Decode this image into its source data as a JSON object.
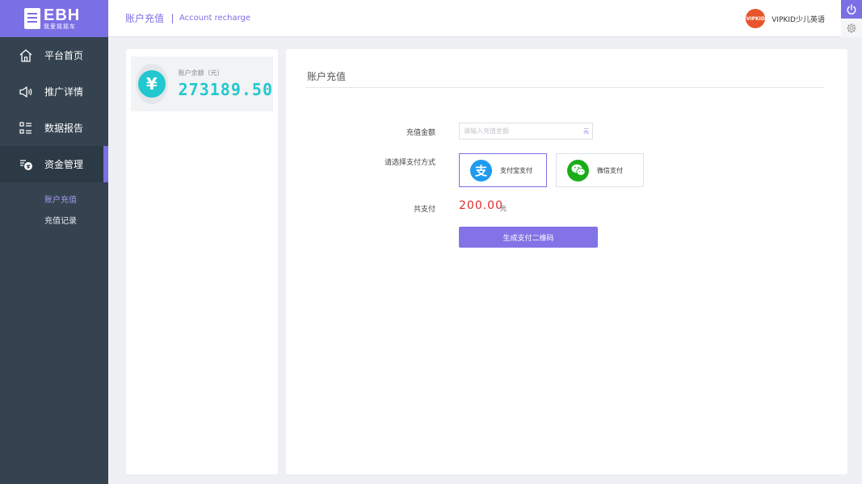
{
  "brand": {
    "logo_text": "EBH",
    "logo_sub": "我爱摇摇车",
    "accent_color": "#7b6fe5"
  },
  "sidebar": {
    "items": [
      {
        "label": "平台首页",
        "icon": "home-icon"
      },
      {
        "label": "推广详情",
        "icon": "speaker-icon"
      },
      {
        "label": "数据报告",
        "icon": "report-list-icon"
      },
      {
        "label": "资金管理",
        "icon": "fund-icon",
        "active": true
      }
    ],
    "sub_items": [
      {
        "label": "账户充值",
        "active": true
      },
      {
        "label": "充值记录"
      }
    ]
  },
  "header": {
    "breadcrumb_zh": "账户充值",
    "breadcrumb_en": "Account recharge",
    "user_name": "VIPKID少儿英语",
    "avatar_text": "VIPKID"
  },
  "balance": {
    "label": "账户余额（元）",
    "value": "273189.50",
    "icon_symbol": "¥",
    "color": "#22c7cf"
  },
  "recharge": {
    "title": "账户充值",
    "amount_label": "充值金额",
    "amount_placeholder": "请输入充值金额",
    "amount_unit": "元",
    "method_label": "请选择支付方式",
    "methods": [
      {
        "label": "支付宝支付",
        "icon": "alipay-icon",
        "icon_symbol": "支",
        "selected": true
      },
      {
        "label": "微信支付",
        "icon": "wechat-icon",
        "selected": false
      }
    ],
    "total_label": "共支付",
    "total_value": "200.00",
    "total_unit": "元",
    "button_label": "生成支付二维码",
    "total_color": "#e12d2d"
  }
}
